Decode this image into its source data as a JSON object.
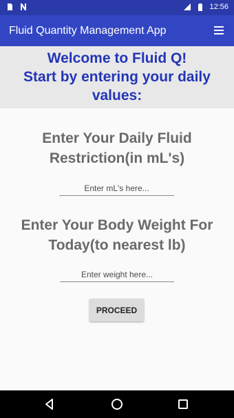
{
  "status_bar": {
    "time": "12:56",
    "left_icons": [
      "sd-card-icon",
      "notification-n-icon"
    ],
    "right_icons": [
      "signal-icon",
      "battery-icon"
    ]
  },
  "app_bar": {
    "title": "Fluid Quantity Management App",
    "menu_icon": "hamburger-menu-icon",
    "color": "#3246c4"
  },
  "welcome": {
    "lines": [
      "Welcome to Fluid Q!",
      "Start by entering your daily",
      "values:"
    ],
    "color": "#2335b8"
  },
  "fluid_section": {
    "lines": [
      "Enter Your Daily Fluid",
      "Restriction(in mL's)"
    ],
    "input_placeholder": "Enter mL's here...",
    "input_value": ""
  },
  "weight_section": {
    "lines": [
      "Enter Your Body Weight For",
      "Today(to nearest lb)"
    ],
    "input_placeholder": "Enter weight here...",
    "input_value": ""
  },
  "proceed_button": {
    "label": "PROCEED"
  },
  "nav_bar": {
    "buttons": [
      "back-icon",
      "home-icon",
      "recent-apps-icon"
    ]
  }
}
